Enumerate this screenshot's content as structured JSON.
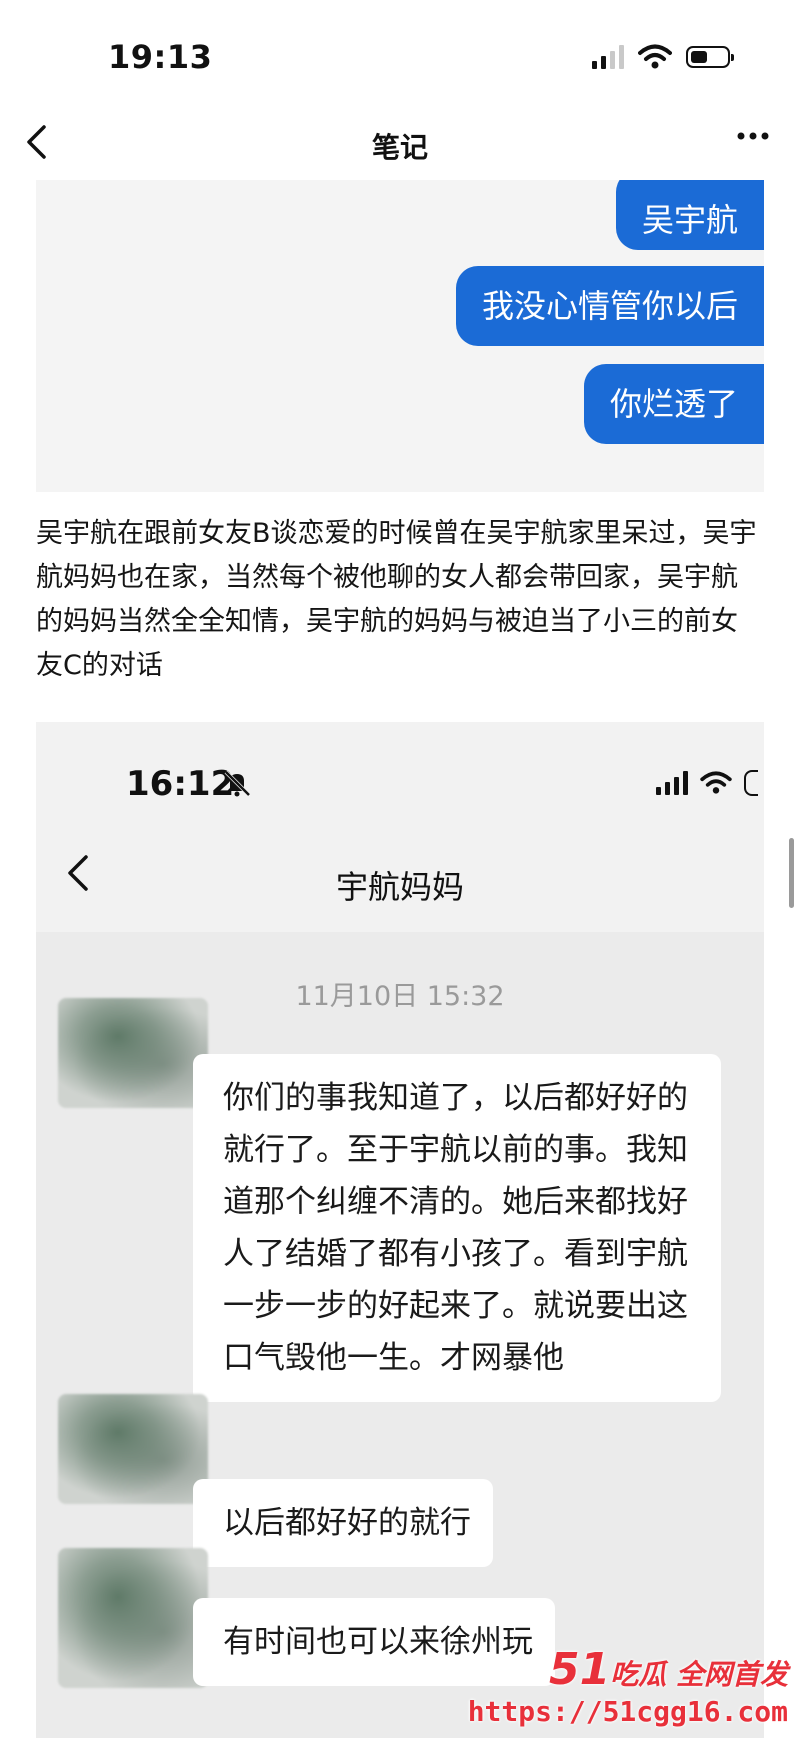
{
  "status_bar": {
    "time": "19:13"
  },
  "nav": {
    "title": "笔记"
  },
  "chat1": {
    "messages": [
      "吴宇航",
      "我没心情管你以后",
      "你烂透了"
    ]
  },
  "description": "吴宇航在跟前女友B谈恋爱的时候曾在吴宇航家里呆过，吴宇航妈妈也在家，当然每个被他聊的女人都会带回家，吴宇航的妈妈当然全全知情，吴宇航的妈妈与被迫当了小三的前女友C的对话",
  "chat2": {
    "status_time": "16:12",
    "title": "宇航妈妈",
    "timestamp": "11月10日 15:32",
    "messages": [
      "你们的事我知道了，以后都好好的就行了。至于宇航以前的事。我知道那个纠缠不清的。她后来都找好人了结婚了都有小孩了。看到宇航一步一步的好起来了。就说要出这口气毁他一生。才网暴他",
      "以后都好好的就行",
      "有时间也可以来徐州玩"
    ]
  },
  "watermark": {
    "brand_num": "51",
    "brand_text": "吃瓜 全网首发",
    "url": "https://51cgg16.com"
  }
}
